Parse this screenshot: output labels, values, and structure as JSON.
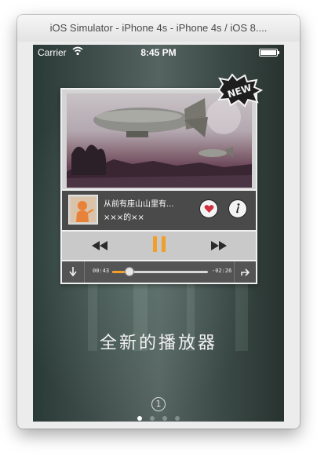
{
  "window": {
    "title": "iOS Simulator - iPhone 4s - iPhone 4s / iOS 8...."
  },
  "status_bar": {
    "carrier": "Carrier",
    "time": "8:45 PM",
    "wifi_icon": "wifi-icon",
    "battery_icon": "battery-icon"
  },
  "badge": {
    "label": "NEW"
  },
  "player": {
    "song_title": "从前有座山山里有...",
    "artist": "×××的××",
    "elapsed": "00:43",
    "remaining": "-02:26",
    "progress": 0.18,
    "playing": true,
    "accent_color": "#f0a02a",
    "icons": {
      "like": "heart-icon",
      "info": "info-icon",
      "rewind": "rewind-icon",
      "pause": "pause-icon",
      "fast_forward": "fast-forward-icon",
      "download": "download-icon",
      "share": "share-icon"
    }
  },
  "intro": {
    "tagline": "全新的播放器",
    "page_number": "1",
    "page_count": 4,
    "current_page": 1
  }
}
